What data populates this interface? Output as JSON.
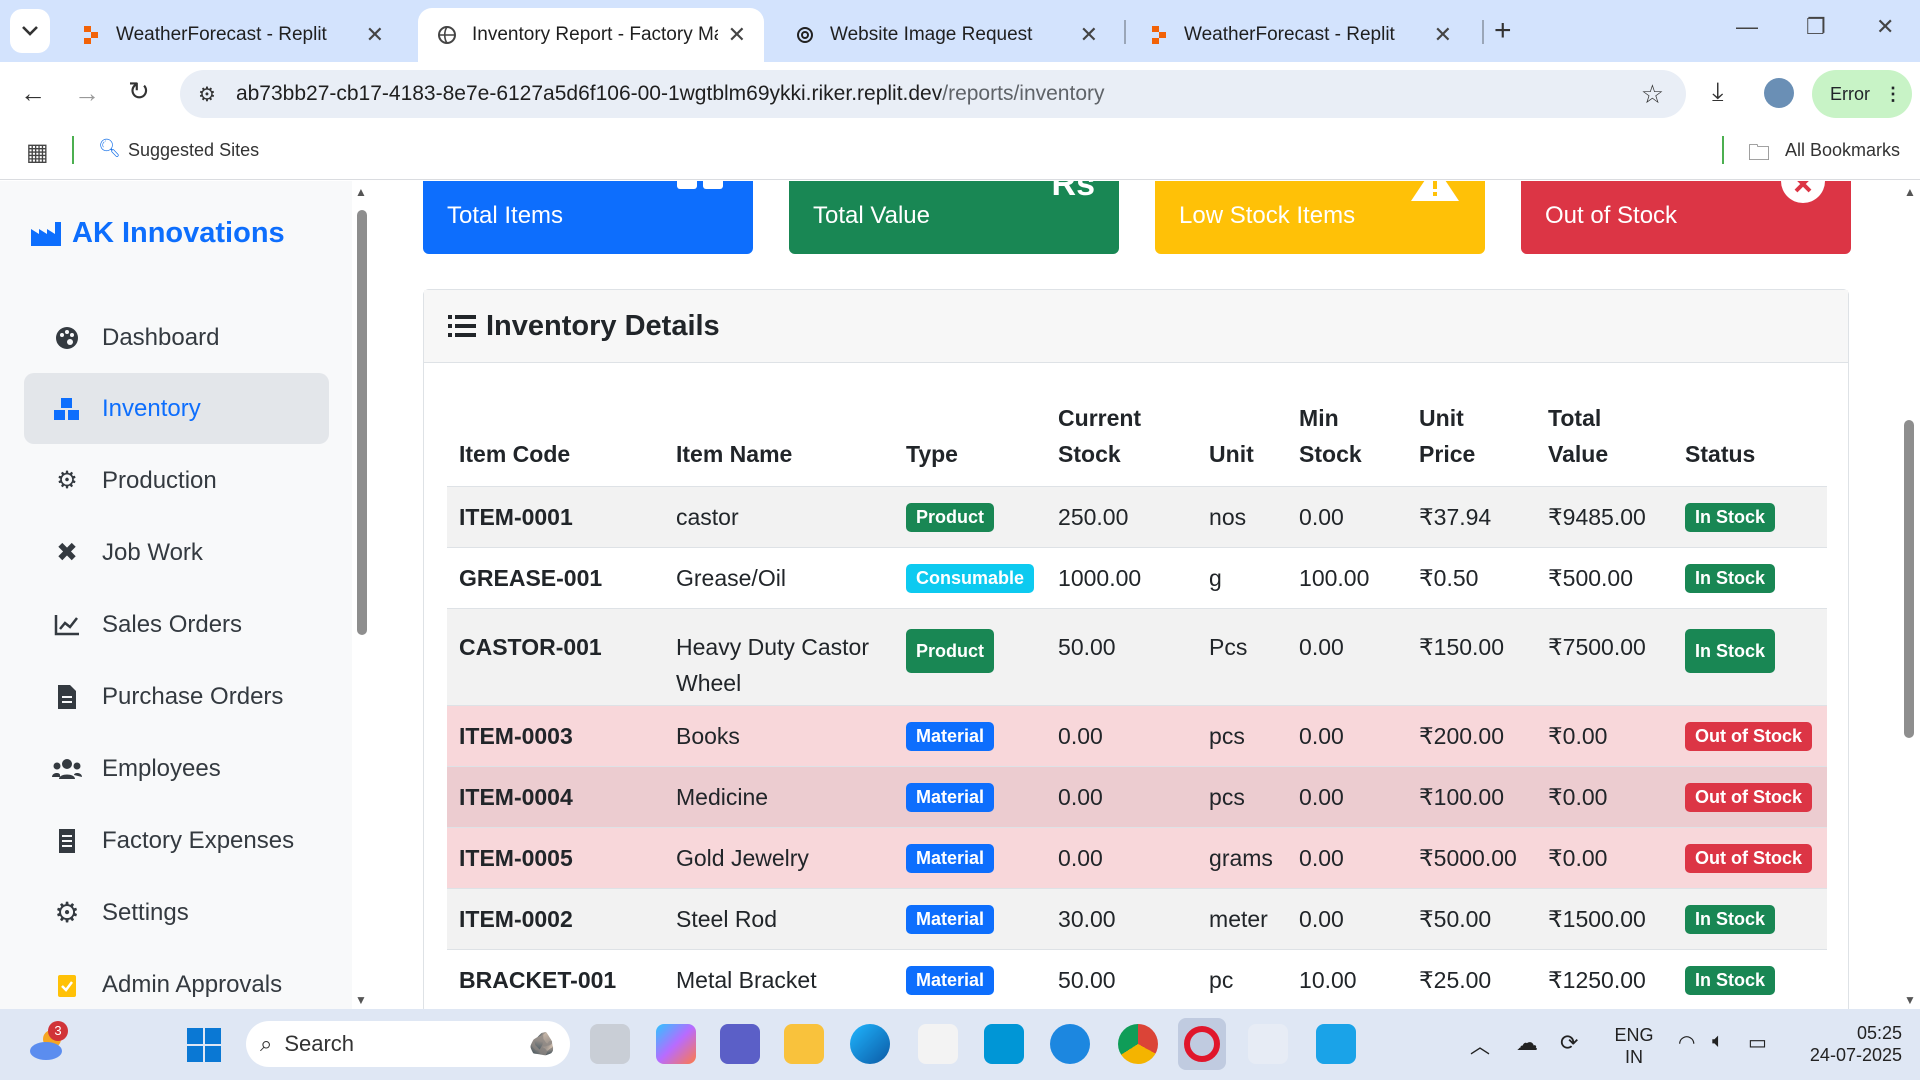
{
  "browser": {
    "tabs": [
      {
        "title": "WeatherForecast - Replit"
      },
      {
        "title": "Inventory Report - Factory Man"
      },
      {
        "title": "Website Image Request"
      },
      {
        "title": "WeatherForecast - Replit"
      }
    ],
    "url_host": "ab73bb27-cb17-4183-8e7e-6127a5d6f106-00-1wgtblm69ykki.riker.replit.dev",
    "url_path": "/reports/inventory",
    "profile_status": "Error",
    "bookmarks": {
      "suggested": "Suggested Sites",
      "all": "All Bookmarks"
    }
  },
  "sidebar": {
    "brand": "AK Innovations",
    "items": [
      {
        "label": "Dashboard",
        "icon": "palette-icon"
      },
      {
        "label": "Inventory",
        "icon": "boxes-icon"
      },
      {
        "label": "Production",
        "icon": "cogs-icon"
      },
      {
        "label": "Job Work",
        "icon": "tools-icon"
      },
      {
        "label": "Sales Orders",
        "icon": "chart-line-icon"
      },
      {
        "label": "Purchase Orders",
        "icon": "file-invoice-icon"
      },
      {
        "label": "Employees",
        "icon": "users-icon"
      },
      {
        "label": "Factory Expenses",
        "icon": "receipt-icon"
      },
      {
        "label": "Settings",
        "icon": "gear-icon"
      },
      {
        "label": "Admin Approvals",
        "icon": "clipboard-check-icon"
      }
    ]
  },
  "summary_cards": [
    {
      "label": "Total Items",
      "color": "#0d6efd"
    },
    {
      "label": "Total Value",
      "color": "#198754",
      "icon_text": "Rs"
    },
    {
      "label": "Low Stock Items",
      "color": "#ffc107"
    },
    {
      "label": "Out of Stock",
      "color": "#dc3545"
    }
  ],
  "inventory": {
    "title": "Inventory Details",
    "headers": {
      "code": "Item Code",
      "name": "Item Name",
      "type": "Type",
      "stock_1": "Current",
      "stock_2": "Stock",
      "unit": "Unit",
      "min_1": "Min",
      "min_2": "Stock",
      "price_1": "Unit",
      "price_2": "Price",
      "total_1": "Total",
      "total_2": "Value",
      "status": "Status"
    },
    "rows": [
      {
        "code": "ITEM-0001",
        "name": "castor",
        "type": "Product",
        "stock": "250.00",
        "unit": "nos",
        "min": "0.00",
        "price": "₹37.94",
        "total": "₹9485.00",
        "status": "In Stock"
      },
      {
        "code": "GREASE-001",
        "name": "Grease/Oil",
        "type": "Consumable",
        "stock": "1000.00",
        "unit": "g",
        "min": "100.00",
        "price": "₹0.50",
        "total": "₹500.00",
        "status": "In Stock"
      },
      {
        "code": "CASTOR-001",
        "name": "Heavy Duty Castor Wheel",
        "type": "Product",
        "stock": "50.00",
        "unit": "Pcs",
        "min": "0.00",
        "price": "₹150.00",
        "total": "₹7500.00",
        "status": "In Stock"
      },
      {
        "code": "ITEM-0003",
        "name": "Books",
        "type": "Material",
        "stock": "0.00",
        "unit": "pcs",
        "min": "0.00",
        "price": "₹200.00",
        "total": "₹0.00",
        "status": "Out of Stock"
      },
      {
        "code": "ITEM-0004",
        "name": "Medicine",
        "type": "Material",
        "stock": "0.00",
        "unit": "pcs",
        "min": "0.00",
        "price": "₹100.00",
        "total": "₹0.00",
        "status": "Out of Stock"
      },
      {
        "code": "ITEM-0005",
        "name": "Gold Jewelry",
        "type": "Material",
        "stock": "0.00",
        "unit": "grams",
        "min": "0.00",
        "price": "₹5000.00",
        "total": "₹0.00",
        "status": "Out of Stock"
      },
      {
        "code": "ITEM-0002",
        "name": "Steel Rod",
        "type": "Material",
        "stock": "30.00",
        "unit": "meter",
        "min": "0.00",
        "price": "₹50.00",
        "total": "₹1500.00",
        "status": "In Stock"
      },
      {
        "code": "BRACKET-001",
        "name": "Metal Bracket",
        "type": "Material",
        "stock": "50.00",
        "unit": "pc",
        "min": "10.00",
        "price": "₹25.00",
        "total": "₹1250.00",
        "status": "In Stock"
      }
    ]
  },
  "taskbar": {
    "search_placeholder": "Search",
    "weather_badge": "3",
    "lang_1": "ENG",
    "lang_2": "IN",
    "time": "05:25",
    "date": "24-07-2025"
  }
}
